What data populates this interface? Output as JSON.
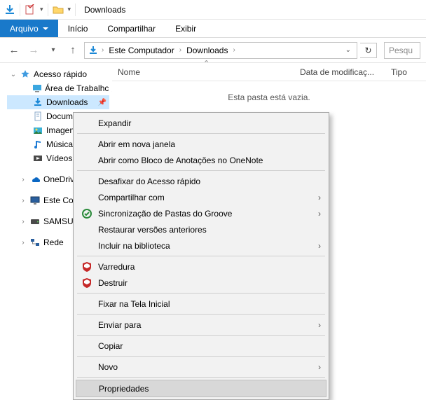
{
  "window": {
    "title": "Downloads"
  },
  "ribbon": {
    "file": "Arquivo",
    "home": "Início",
    "share": "Compartilhar",
    "view": "Exibir"
  },
  "breadcrumb": {
    "segments": [
      "Este Computador",
      "Downloads"
    ]
  },
  "search": {
    "placeholder": "Pesqu"
  },
  "columns": {
    "name": "Nome",
    "dateModified": "Data de modificaç...",
    "type": "Tipo"
  },
  "content": {
    "empty": "Esta pasta está vazia."
  },
  "tree": {
    "quickAccess": "Acesso rápido",
    "desktop": "Área de Trabalhc",
    "downloads": "Downloads",
    "documents": "Documentos",
    "pictures": "Imagens",
    "music": "Música",
    "videos": "Vídeos",
    "onedrive": "OneDrive",
    "thisPc": "Este Computador",
    "samsung": "SAMSUNG",
    "network": "Rede"
  },
  "context_menu": {
    "expand": "Expandir",
    "openNew": "Abrir em nova janela",
    "onenote": "Abrir como Bloco de Anotações no OneNote",
    "unpin": "Desafixar do Acesso rápido",
    "shareWith": "Compartilhar com",
    "groove": "Sincronização de Pastas do Groove",
    "restore": "Restaurar versões anteriores",
    "library": "Incluir na biblioteca",
    "scan": "Varredura",
    "destroy": "Destruir",
    "pinStart": "Fixar na Tela Inicial",
    "sendTo": "Enviar para",
    "copy": "Copiar",
    "new": "Novo",
    "properties": "Propriedades"
  }
}
